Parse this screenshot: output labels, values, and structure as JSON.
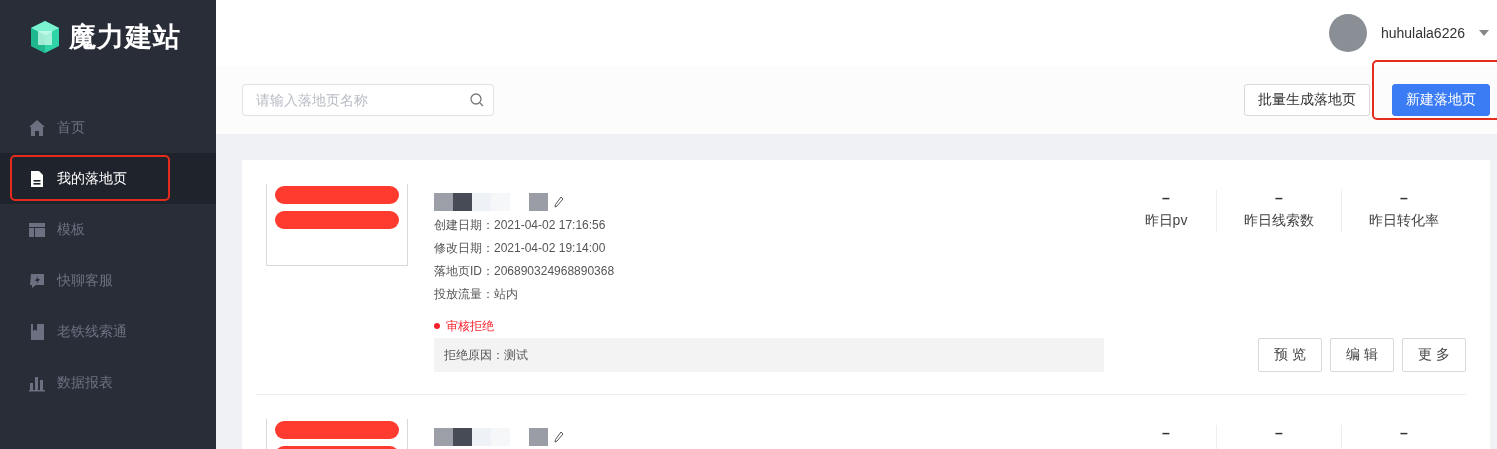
{
  "brand": {
    "name": "魔力建站"
  },
  "sidebar": {
    "items": [
      {
        "label": "首页",
        "selected": false,
        "highlighted": false
      },
      {
        "label": "我的落地页",
        "selected": true,
        "highlighted": true
      },
      {
        "label": "模板",
        "selected": false,
        "highlighted": false
      },
      {
        "label": "快聊客服",
        "selected": false,
        "highlighted": false
      },
      {
        "label": "老铁线索通",
        "selected": false,
        "highlighted": false
      },
      {
        "label": "数据报表",
        "selected": false,
        "highlighted": false
      }
    ]
  },
  "user": {
    "name": "huhulala6226"
  },
  "toolbar": {
    "search": {
      "placeholder": "请输入落地页名称"
    },
    "buttons": [
      {
        "label": "批量生成落地页",
        "kind": "default",
        "highlighted": false
      },
      {
        "label": "新建落地页",
        "kind": "primary",
        "highlighted": true
      }
    ]
  },
  "landing_pages": [
    {
      "fields": [
        {
          "label": "创建日期：",
          "value": "2021-04-02 17:16:56"
        },
        {
          "label": "修改日期：",
          "value": "2021-04-02 19:14:00"
        },
        {
          "label": "落地页ID：",
          "value": "206890324968890368"
        },
        {
          "label": "投放流量：",
          "value": "站内"
        }
      ],
      "status": "审核拒绝",
      "reason": "拒绝原因：测试",
      "stats": [
        {
          "value": "–",
          "label": "昨日pv"
        },
        {
          "value": "–",
          "label": "昨日线索数"
        },
        {
          "value": "–",
          "label": "昨日转化率"
        }
      ],
      "actions": [
        "预 览",
        "编 辑",
        "更 多"
      ]
    },
    {
      "stats": [
        {
          "value": "–"
        },
        {
          "value": "–"
        },
        {
          "value": "–"
        }
      ]
    }
  ]
}
